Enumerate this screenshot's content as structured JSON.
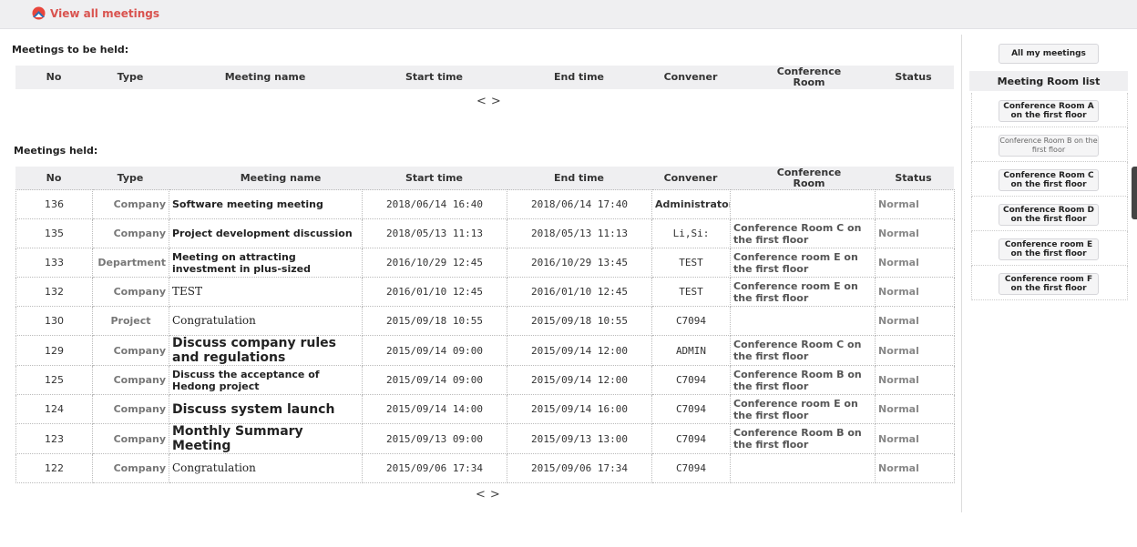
{
  "header": {
    "view_all_label": "View all meetings"
  },
  "upcoming": {
    "title": "Meetings to be held:",
    "columns": [
      "No",
      "Type",
      "Meeting name",
      "Start time",
      "End time",
      "Convener",
      "Conference Room",
      "Status"
    ],
    "pager": {
      "prev": "<",
      "next": ">"
    }
  },
  "held": {
    "title": "Meetings held:",
    "columns": [
      "No",
      "Type",
      "Meeting name",
      "Start time",
      "End time",
      "Convener",
      "Conference Room",
      "Status"
    ],
    "rows": [
      {
        "no": "136",
        "type": "Company",
        "name": "Software meeting meeting",
        "start": "2018/06/14 16:40",
        "end": "2018/06/14 17:40",
        "convener": "Administrator",
        "room": "",
        "status": "Normal"
      },
      {
        "no": "135",
        "type": "Company",
        "name": "Project development discussion",
        "start": "2018/05/13 11:13",
        "end": "2018/05/13 11:13",
        "convener": "Li,Si:",
        "room": "Conference Room C on the first floor",
        "status": "Normal"
      },
      {
        "no": "133",
        "type": "Department",
        "name": "Meeting on attracting investment in plus-sized",
        "start": "2016/10/29 12:45",
        "end": "2016/10/29 13:45",
        "convener": "TEST",
        "room": "Conference room E on the first floor",
        "status": "Normal"
      },
      {
        "no": "132",
        "type": "Company",
        "name": "TEST",
        "start": "2016/01/10 12:45",
        "end": "2016/01/10 12:45",
        "convener": "TEST",
        "room": "Conference room E on the first floor",
        "status": "Normal"
      },
      {
        "no": "130",
        "type": "Project",
        "name": "Congratulation",
        "start": "2015/09/18 10:55",
        "end": "2015/09/18 10:55",
        "convener": "C7094",
        "room": "",
        "status": "Normal"
      },
      {
        "no": "129",
        "type": "Company",
        "name": "Discuss company rules and regulations",
        "start": "2015/09/14 09:00",
        "end": "2015/09/14 12:00",
        "convener": "ADMIN",
        "room": "Conference Room C on the first floor",
        "status": "Normal"
      },
      {
        "no": "125",
        "type": "Company",
        "name": "Discuss the acceptance of Hedong project",
        "start": "2015/09/14 09:00",
        "end": "2015/09/14 12:00",
        "convener": "C7094",
        "room": "Conference Room B on the first floor",
        "status": "Normal"
      },
      {
        "no": "124",
        "type": "Company",
        "name": "Discuss system launch",
        "start": "2015/09/14 14:00",
        "end": "2015/09/14 16:00",
        "convener": "C7094",
        "room": "Conference room E on the first floor",
        "status": "Normal"
      },
      {
        "no": "123",
        "type": "Company",
        "name": "Monthly Summary Meeting",
        "start": "2015/09/13 09:00",
        "end": "2015/09/13 13:00",
        "convener": "C7094",
        "room": "Conference Room B on the first floor",
        "status": "Normal"
      },
      {
        "no": "122",
        "type": "Company",
        "name": "Congratulation",
        "start": "2015/09/06 17:34",
        "end": "2015/09/06 17:34",
        "convener": "C7094",
        "room": "",
        "status": "Normal"
      }
    ],
    "pager": {
      "prev": "<",
      "next": ">"
    }
  },
  "sidebar": {
    "all_my_meetings": "All my meetings",
    "room_list_title": "Meeting Room list",
    "rooms": [
      "Conference Room A on the first floor",
      "Conference Room B on the first floor",
      "Conference Room C on the first floor",
      "Conference Room D on the first floor",
      "Conference room E on the first floor",
      "Conference room F on the first floor"
    ]
  },
  "colors": {
    "accent": "#d9534f",
    "header_bg": "#efeff1",
    "status": "#888888"
  }
}
